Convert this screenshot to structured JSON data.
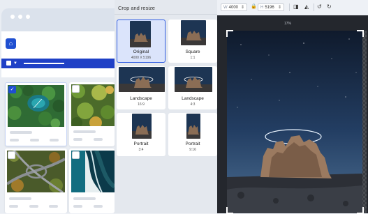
{
  "crop_panel": {
    "title": "Crop and resize",
    "options": [
      {
        "label": "Original",
        "sub": "4000 X 5196",
        "selected": true
      },
      {
        "label": "Square",
        "sub": "1:1",
        "selected": false
      },
      {
        "label": "Landscape",
        "sub": "16:9",
        "selected": false
      },
      {
        "label": "Landscape",
        "sub": "4:3",
        "selected": false
      },
      {
        "label": "Portrait",
        "sub": "3:4",
        "selected": false
      },
      {
        "label": "Portrait",
        "sub": "9:16",
        "selected": false
      }
    ]
  },
  "toolbar": {
    "width_unit": "W",
    "width_value": "4000",
    "height_unit": "H",
    "height_value": "5196"
  },
  "preview": {
    "zoom_label": "17%"
  },
  "gallery": {
    "selected_check": "✓"
  },
  "colors": {
    "accent": "#1f4fd1",
    "selection": "#2d5be3"
  }
}
